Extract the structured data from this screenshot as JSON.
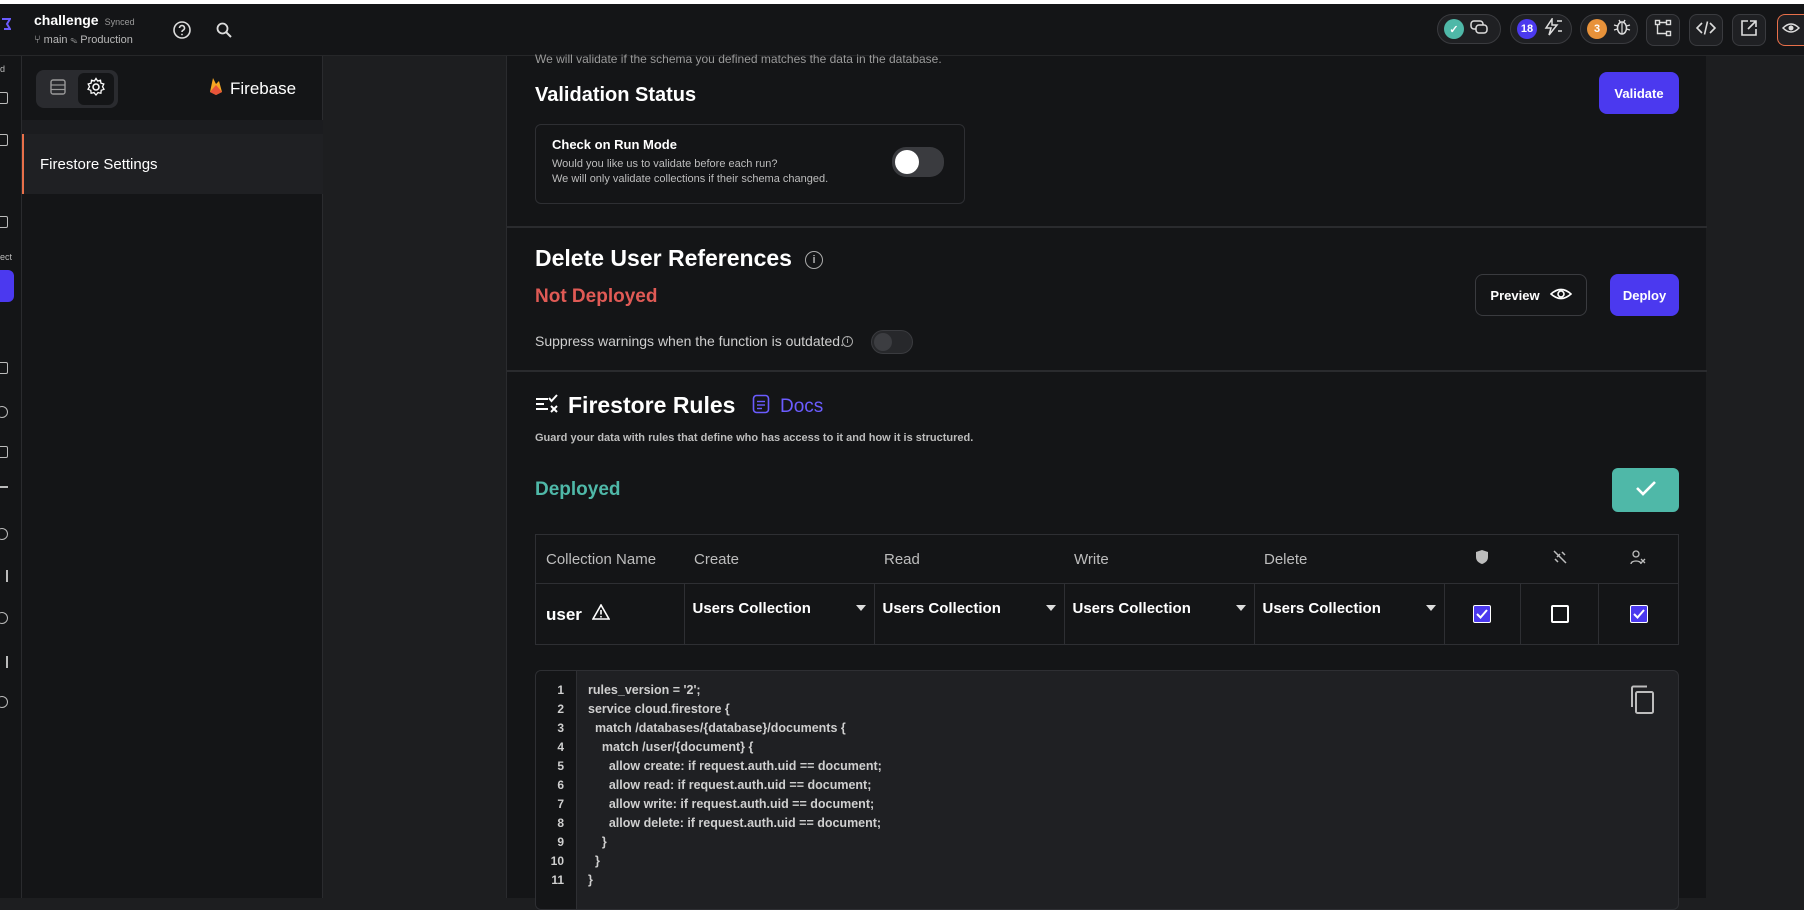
{
  "project": {
    "name": "challenge",
    "sync_status": "Synced",
    "branch": "main",
    "environment": "Production"
  },
  "topbar": {
    "ai_badge_count": "18",
    "bug_badge_count": "3"
  },
  "sidebar": {
    "brand": "Firebase",
    "items": [
      {
        "label": "Firestore Settings"
      }
    ]
  },
  "rail": {
    "labels": [
      "d",
      "ect"
    ]
  },
  "validation": {
    "cropped_text": "We will validate if the schema you defined matches the data in the database.",
    "title": "Validation Status",
    "validate_label": "Validate",
    "check_title": "Check on Run Mode",
    "check_desc1": "Would you like us to validate before each run?",
    "check_desc2": "We will only validate collections if their schema changed."
  },
  "delete_refs": {
    "title": "Delete User References",
    "status": "Not Deployed",
    "suppress_label": "Suppress warnings when the function is outdated.",
    "preview_label": "Preview",
    "deploy_label": "Deploy"
  },
  "rules": {
    "title": "Firestore Rules",
    "docs_label": "Docs",
    "subtitle": "Guard your data with rules that define who has access to it and how it is structured.",
    "status": "Deployed",
    "columns": [
      "Collection Name",
      "Create",
      "Read",
      "Write",
      "Delete"
    ],
    "rows": [
      {
        "collection": "user",
        "create": "Users Collection",
        "read": "Users Collection",
        "write": "Users Collection",
        "delete": "Users Collection"
      }
    ],
    "code_lines": [
      "rules_version = '2';",
      "service cloud.firestore {",
      "  match /databases/{database}/documents {",
      "    match /user/{document} {",
      "      allow create: if request.auth.uid == document;",
      "      allow read: if request.auth.uid == document;",
      "      allow write: if request.auth.uid == document;",
      "      allow delete: if request.auth.uid == document;",
      "    }",
      "  }",
      "}"
    ],
    "line_numbers": [
      "1",
      "2",
      "3",
      "4",
      "5",
      "6",
      "7",
      "8",
      "9",
      "10",
      "11"
    ]
  },
  "colors": {
    "accent": "#4b39ef",
    "not_deployed": "#e05a55",
    "deployed": "#4fb8a8"
  }
}
